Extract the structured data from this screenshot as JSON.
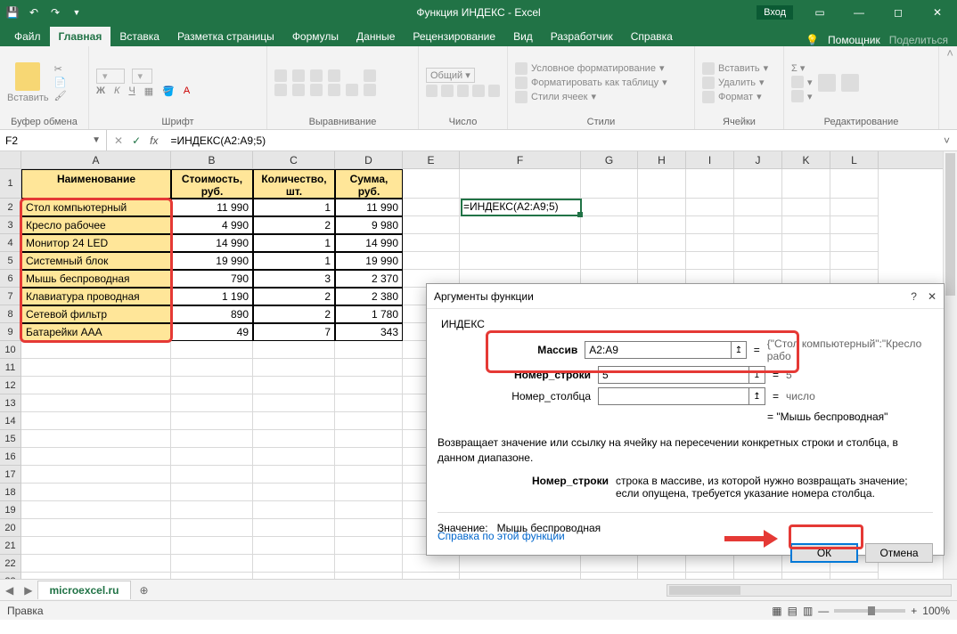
{
  "title": "Функция ИНДЕКС  -  Excel",
  "login": "Вход",
  "tabs": [
    "Файл",
    "Главная",
    "Вставка",
    "Разметка страницы",
    "Формулы",
    "Данные",
    "Рецензирование",
    "Вид",
    "Разработчик",
    "Справка"
  ],
  "active_tab": 1,
  "help_icon_label": "Помощник",
  "share_label": "Поделиться",
  "ribbon_groups": {
    "clipboard": "Буфер обмена",
    "font": "Шрифт",
    "alignment": "Выравнивание",
    "number": "Число",
    "styles": "Стили",
    "cells": "Ячейки",
    "editing": "Редактирование"
  },
  "ribbon": {
    "paste": "Вставить",
    "number_format": "Общий",
    "cond_fmt": "Условное форматирование",
    "fmt_table": "Форматировать как таблицу",
    "cell_styles": "Стили ячеек",
    "insert": "Вставить",
    "delete": "Удалить",
    "format": "Формат",
    "font_letters": {
      "bold": "Ж",
      "italic": "К",
      "underline": "Ч"
    }
  },
  "namebox": "F2",
  "formula": "=ИНДЕКС(A2:A9;5)",
  "columns": [
    {
      "letter": "A",
      "w": 168
    },
    {
      "letter": "B",
      "w": 92
    },
    {
      "letter": "C",
      "w": 92
    },
    {
      "letter": "D",
      "w": 76
    },
    {
      "letter": "E",
      "w": 64
    },
    {
      "letter": "F",
      "w": 136
    },
    {
      "letter": "G",
      "w": 64
    },
    {
      "letter": "H",
      "w": 54
    },
    {
      "letter": "I",
      "w": 54
    },
    {
      "letter": "J",
      "w": 54
    },
    {
      "letter": "K",
      "w": 54
    },
    {
      "letter": "L",
      "w": 54
    }
  ],
  "headers": [
    "Наименование",
    "Стоимость, руб.",
    "Количество, шт.",
    "Сумма, руб."
  ],
  "table": [
    {
      "name": "Стол компьютерный",
      "cost": "11 990",
      "qty": "1",
      "sum": "11 990"
    },
    {
      "name": "Кресло рабочее",
      "cost": "4 990",
      "qty": "2",
      "sum": "9 980"
    },
    {
      "name": "Монитор 24 LED",
      "cost": "14 990",
      "qty": "1",
      "sum": "14 990"
    },
    {
      "name": "Системный блок",
      "cost": "19 990",
      "qty": "1",
      "sum": "19 990"
    },
    {
      "name": "Мышь беспроводная",
      "cost": "790",
      "qty": "3",
      "sum": "2 370"
    },
    {
      "name": "Клавиатура проводная",
      "cost": "1 190",
      "qty": "2",
      "sum": "2 380"
    },
    {
      "name": "Сетевой фильтр",
      "cost": "890",
      "qty": "2",
      "sum": "1 780"
    },
    {
      "name": "Батарейки AAA",
      "cost": "49",
      "qty": "7",
      "sum": "343"
    }
  ],
  "f2_display": "=ИНДЕКС(A2:A9;5)",
  "blank_rows": 14,
  "sheet_tab": "microexcel.ru",
  "status_left": "Правка",
  "zoom": "100%",
  "dialog": {
    "title": "Аргументы функции",
    "func": "ИНДЕКС",
    "args": [
      {
        "label": "Массив",
        "value": "A2:A9",
        "result": "{\"Стол компьютерный\":\"Кресло рабо"
      },
      {
        "label": "Номер_строки",
        "value": "5",
        "result": "5"
      },
      {
        "label": "Номер_столбца",
        "value": "",
        "result": "число"
      }
    ],
    "preview_eq": "=  \"Мышь беспроводная\"",
    "desc": "Возвращает значение или ссылку на ячейку на пересечении конкретных строки и столбца, в данном диапазоне.",
    "arg_desc_label": "Номер_строки",
    "arg_desc_text": "строка в массиве, из которой нужно возвращать значение; если опущена, требуется указание номера столбца.",
    "value_label": "Значение:",
    "value": "Мышь беспроводная",
    "help": "Справка по этой функции",
    "ok": "ОК",
    "cancel": "Отмена"
  }
}
